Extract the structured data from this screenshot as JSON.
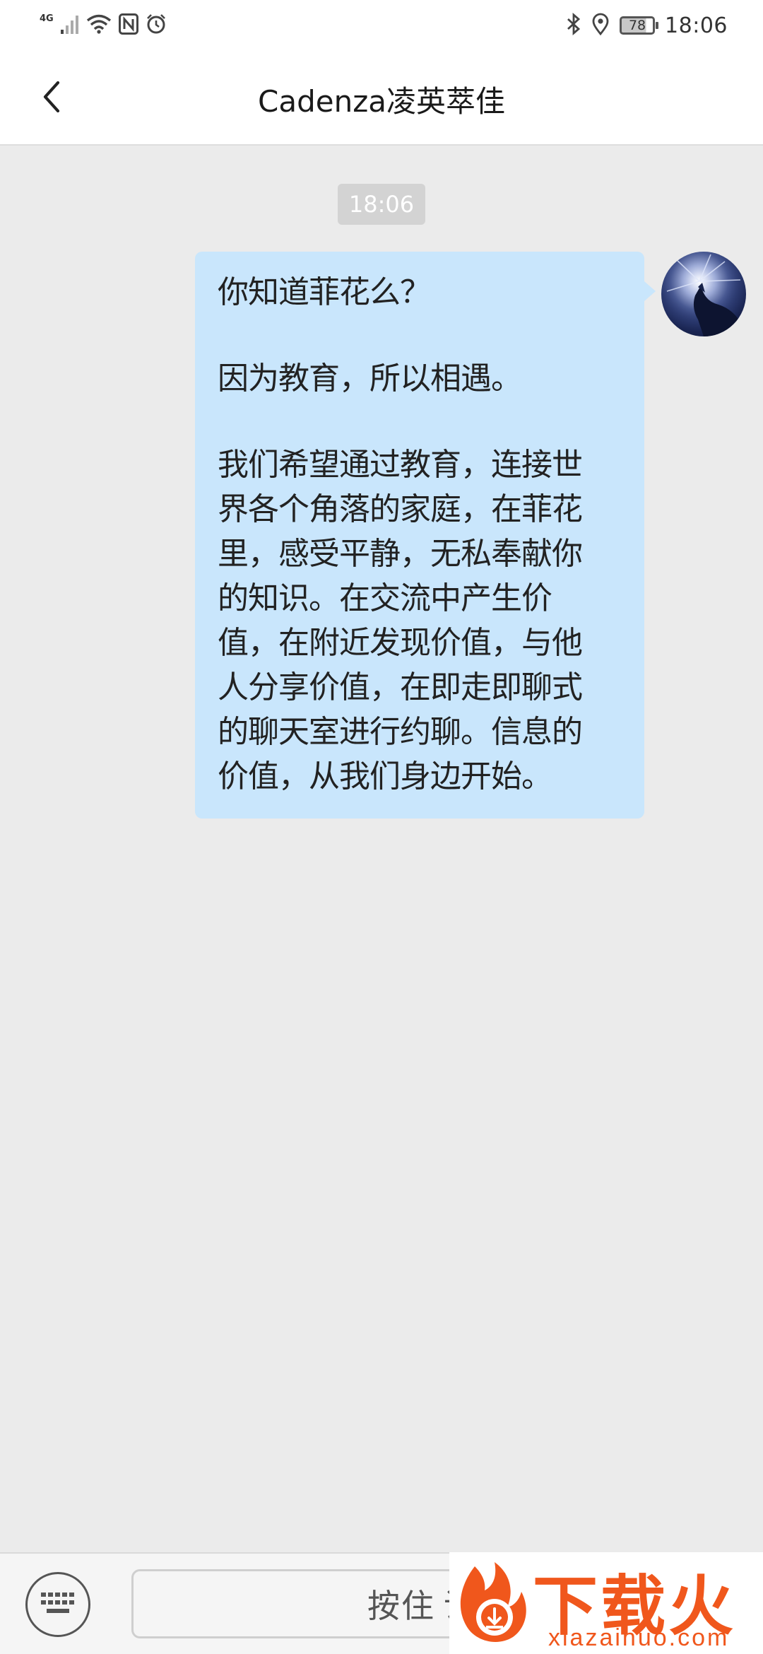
{
  "status_bar": {
    "network": "4G",
    "battery": "78",
    "time": "18:06",
    "icons_left": [
      "signal-icon",
      "wifi-icon",
      "nfc-icon",
      "alarm-icon"
    ],
    "icons_right": [
      "bluetooth-icon",
      "location-icon",
      "battery-icon"
    ]
  },
  "header": {
    "title": "Cadenza凌英萃佳",
    "back_icon": "chevron-left-icon"
  },
  "chat": {
    "timestamp": "18:06",
    "message": {
      "para1": [
        "你知道菲花么？"
      ],
      "para2": [
        "因为教育，所以相遇。"
      ],
      "para3": [
        "我们希望通过教育，连接世",
        "界各个角落的家庭，在菲花",
        "里，感受平静，无私奉献你",
        "的知识。在交流中产生价",
        "值，在附近发现价值，与他",
        "人分享价值，在即走即聊式",
        "的聊天室进行约聊。信息的",
        "价值，从我们身边开始。"
      ]
    }
  },
  "input_bar": {
    "hold_label_1": "按住",
    "hold_label_2": "说话",
    "keyboard_icon": "keyboard-icon"
  },
  "watermark": {
    "logo_text": "下载火",
    "domain": "xiazaihuo.com"
  },
  "colors": {
    "bubble": "#c9e6fc",
    "background": "#ebebeb",
    "watermark": "#f0571c"
  }
}
